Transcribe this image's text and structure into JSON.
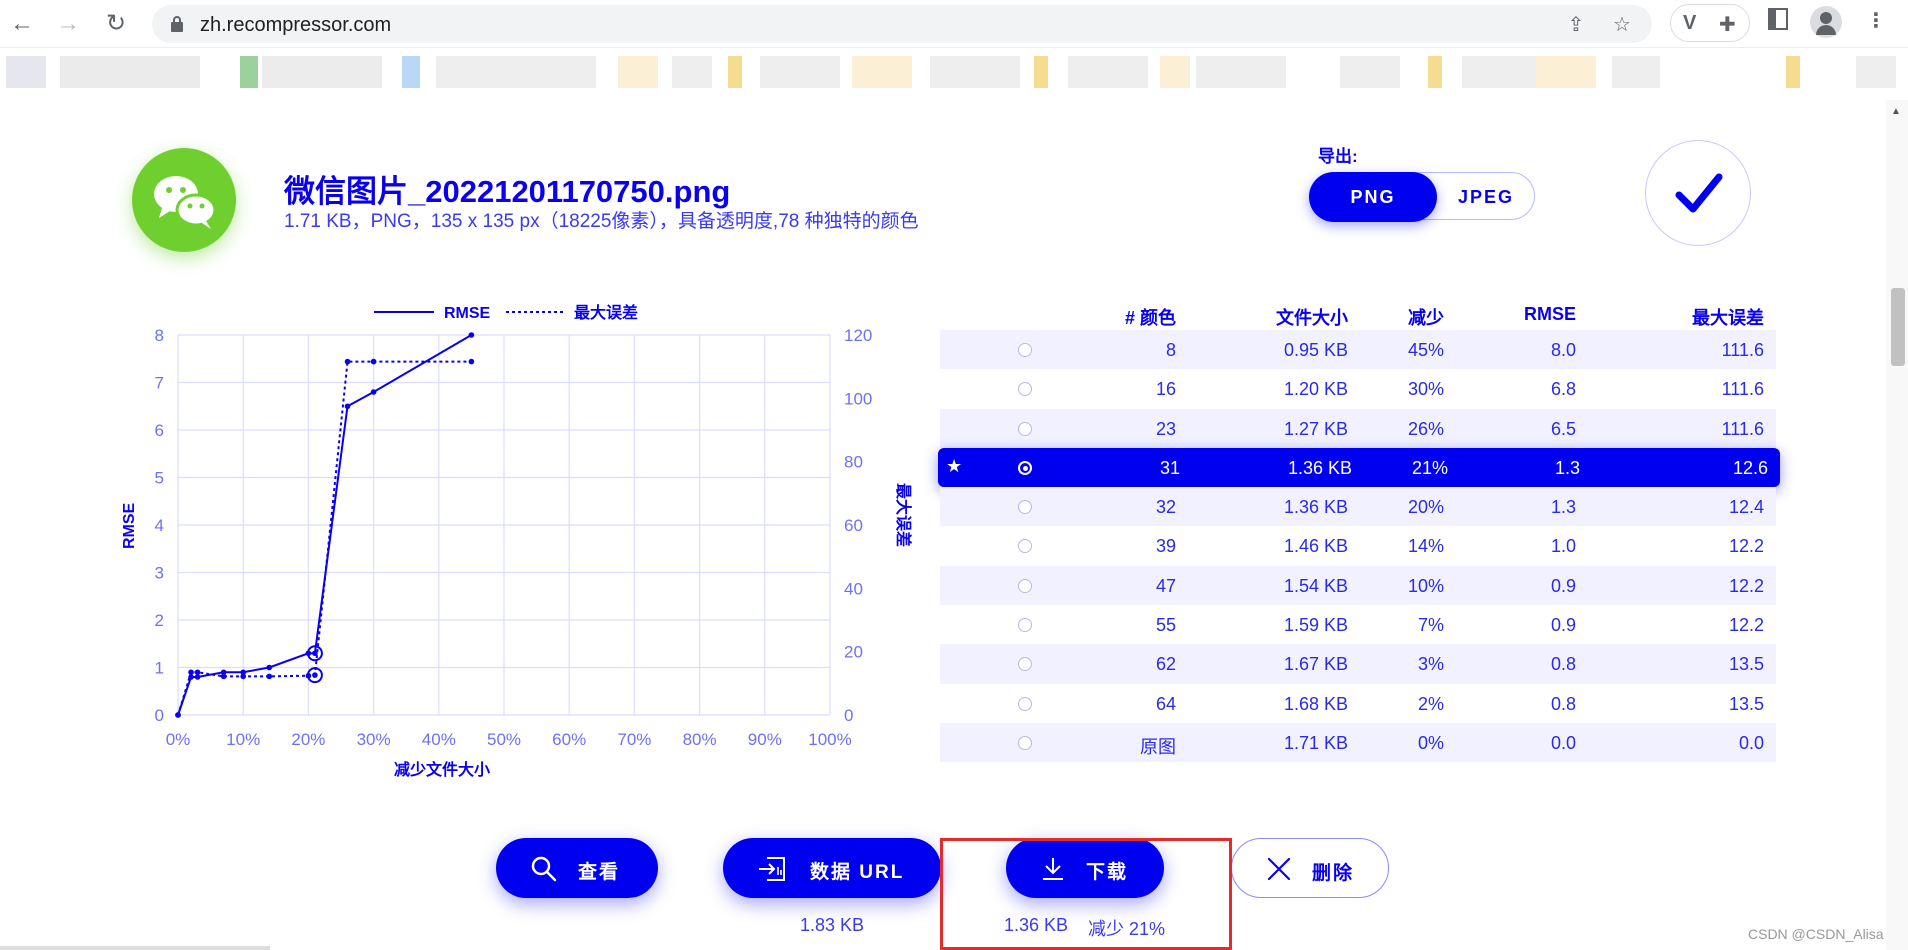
{
  "browser": {
    "url": "zh.recompressor.com",
    "icons": [
      "back-icon",
      "forward-icon",
      "reload-icon",
      "lock-icon",
      "share-icon",
      "star-icon",
      "extension-v-icon",
      "puzzle-icon",
      "sidepanel-icon",
      "profile-icon",
      "menu-icon"
    ]
  },
  "file": {
    "name": "微信图片_20221201170750.png",
    "meta": "1.71 KB，PNG，135 x 135 px（18225像素），具备透明度,78 种独特的颜色",
    "icon": "wechat-icon",
    "icon_color": "#6fcf2f"
  },
  "export": {
    "label": "导出:",
    "options": [
      "PNG",
      "JPEG"
    ],
    "selected": "PNG"
  },
  "chart_data": {
    "type": "line",
    "xlabel": "减少文件大小",
    "ylabel": "RMSE",
    "y2label": "最大误差",
    "xlim": [
      0,
      100
    ],
    "ylim": [
      0,
      8
    ],
    "y2lim": [
      0,
      120
    ],
    "xticks": [
      "0%",
      "10%",
      "20%",
      "30%",
      "40%",
      "50%",
      "60%",
      "70%",
      "80%",
      "90%",
      "100%"
    ],
    "yticks": [
      "0",
      "1",
      "2",
      "3",
      "4",
      "5",
      "6",
      "7",
      "8"
    ],
    "y2ticks": [
      "0",
      "20",
      "40",
      "60",
      "80",
      "100",
      "120"
    ],
    "grid": true,
    "legend": "top",
    "series": [
      {
        "name": "RMSE",
        "axis": "left",
        "style": "solid",
        "x": [
          0,
          2,
          3,
          7,
          10,
          14,
          20,
          21,
          26,
          30,
          45
        ],
        "y": [
          0.0,
          0.8,
          0.8,
          0.9,
          0.9,
          1.0,
          1.3,
          1.3,
          6.5,
          6.8,
          8.0
        ]
      },
      {
        "name": "最大误差",
        "axis": "right",
        "style": "dotted",
        "x": [
          0,
          2,
          3,
          7,
          10,
          14,
          20,
          21,
          26,
          30,
          45
        ],
        "y": [
          0.0,
          13.5,
          13.5,
          12.2,
          12.2,
          12.2,
          12.4,
          12.6,
          111.6,
          111.6,
          111.6
        ]
      }
    ],
    "highlighted_x": 21,
    "color": "#0a00f0"
  },
  "table": {
    "headers": [
      "# 颜色",
      "文件大小",
      "减少",
      "RMSE",
      "最大误差"
    ],
    "rows": [
      {
        "colors": "8",
        "size": "0.95 KB",
        "reduction": "45%",
        "rmse": "8.0",
        "max": "111.6"
      },
      {
        "colors": "16",
        "size": "1.20 KB",
        "reduction": "30%",
        "rmse": "6.8",
        "max": "111.6"
      },
      {
        "colors": "23",
        "size": "1.27 KB",
        "reduction": "26%",
        "rmse": "6.5",
        "max": "111.6"
      },
      {
        "colors": "31",
        "size": "1.36 KB",
        "reduction": "21%",
        "rmse": "1.3",
        "max": "12.6",
        "selected": true,
        "star": "★"
      },
      {
        "colors": "32",
        "size": "1.36 KB",
        "reduction": "20%",
        "rmse": "1.3",
        "max": "12.4"
      },
      {
        "colors": "39",
        "size": "1.46 KB",
        "reduction": "14%",
        "rmse": "1.0",
        "max": "12.2"
      },
      {
        "colors": "47",
        "size": "1.54 KB",
        "reduction": "10%",
        "rmse": "0.9",
        "max": "12.2"
      },
      {
        "colors": "55",
        "size": "1.59 KB",
        "reduction": "7%",
        "rmse": "0.9",
        "max": "12.2"
      },
      {
        "colors": "62",
        "size": "1.67 KB",
        "reduction": "3%",
        "rmse": "0.8",
        "max": "13.5"
      },
      {
        "colors": "64",
        "size": "1.68 KB",
        "reduction": "2%",
        "rmse": "0.8",
        "max": "13.5"
      },
      {
        "colors": "原图",
        "size": "1.71 KB",
        "reduction": "0%",
        "rmse": "0.0",
        "max": "0.0"
      }
    ]
  },
  "actions": {
    "view": "查看",
    "data_url": "数据 URL",
    "data_url_size": "1.83 KB",
    "download": "下载",
    "download_size": "1.36 KB",
    "download_reduction": "减少 21%",
    "delete": "删除"
  },
  "watermark": "CSDN @CSDN_Alisa",
  "colors": {
    "accent": "#0000f0",
    "highlight_box": "#e32b2b",
    "wechat_green": "#6fcf2f"
  }
}
